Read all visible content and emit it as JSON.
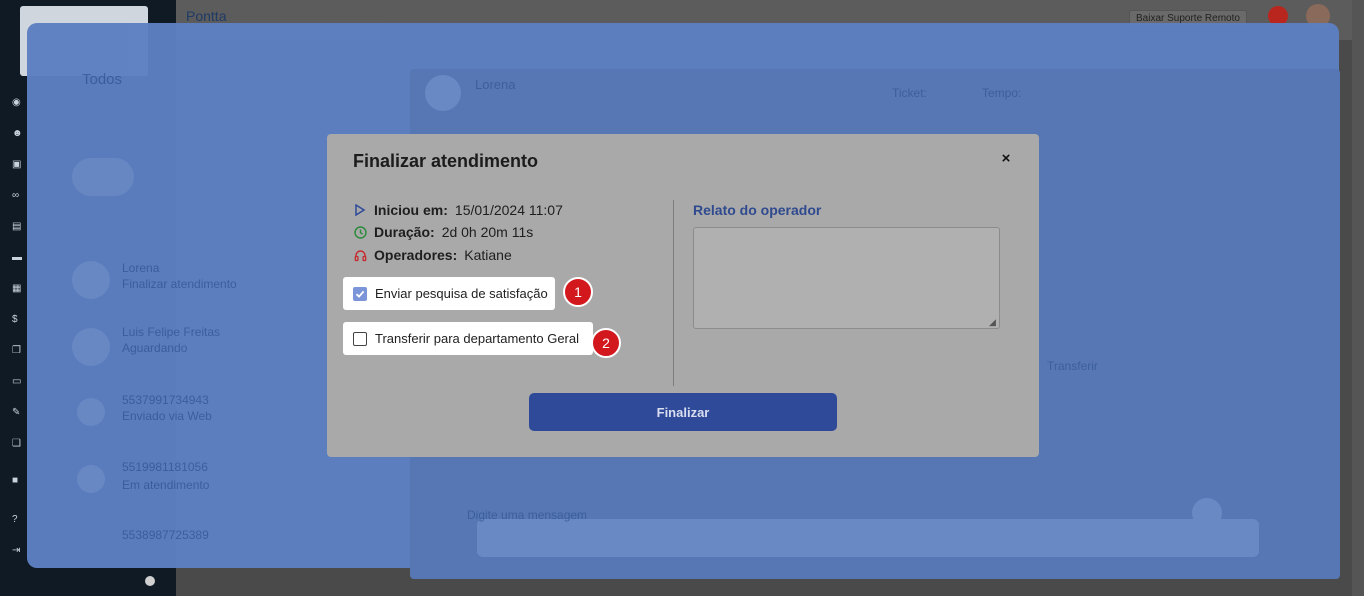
{
  "background": {
    "topbar": {
      "brand": "Pontta",
      "suporte_label": "Baixar Suporte Remoto"
    },
    "list": {
      "filter_label": "Todos",
      "items": [
        {
          "name": "Lorena",
          "preview": "Finalizar atendimento"
        },
        {
          "name": "Luis Felipe Freitas",
          "preview": "Aguardando"
        },
        {
          "name": "5537991734943",
          "preview": "Enviado via Web"
        },
        {
          "name": "5519981181056",
          "preview": "Em atendimento"
        },
        {
          "name": "5538987725389",
          "preview": ""
        }
      ]
    },
    "chat": {
      "contact_name": "Lorena",
      "ticket_label": "Ticket:",
      "tempo_label": "Tempo:",
      "transferir_label": "Transferir",
      "input_placeholder": "Digite uma mensagem"
    }
  },
  "modal": {
    "title": "Finalizar atendimento",
    "close_symbol": "×",
    "info": {
      "inicio_label": "Iniciou em:",
      "inicio_value": "15/01/2024 11:07",
      "duracao_label": "Duração:",
      "duracao_value": "2d 0h 20m 11s",
      "operadores_label": "Operadores:",
      "operadores_value": "Katiane"
    },
    "options": [
      {
        "label": "Enviar pesquisa de satisfação",
        "checked": true,
        "badge": "1"
      },
      {
        "label": "Transferir para departamento Geral",
        "checked": false,
        "badge": "2"
      }
    ],
    "relato": {
      "label": "Relato do operador",
      "value": ""
    },
    "submit_label": "Finalizar"
  },
  "colors": {
    "overlay": "#5d80c2",
    "modal_bg": "#a9a9a9",
    "primary_button": "#2f4a99",
    "badge": "#d3181d",
    "relato_label": "#2f4a8e",
    "checkbox_checked": "#7c95d8"
  },
  "icons": {
    "inicio": "play-triangle-icon",
    "duracao": "clock-icon",
    "operadores": "headset-icon",
    "close": "close-icon"
  }
}
